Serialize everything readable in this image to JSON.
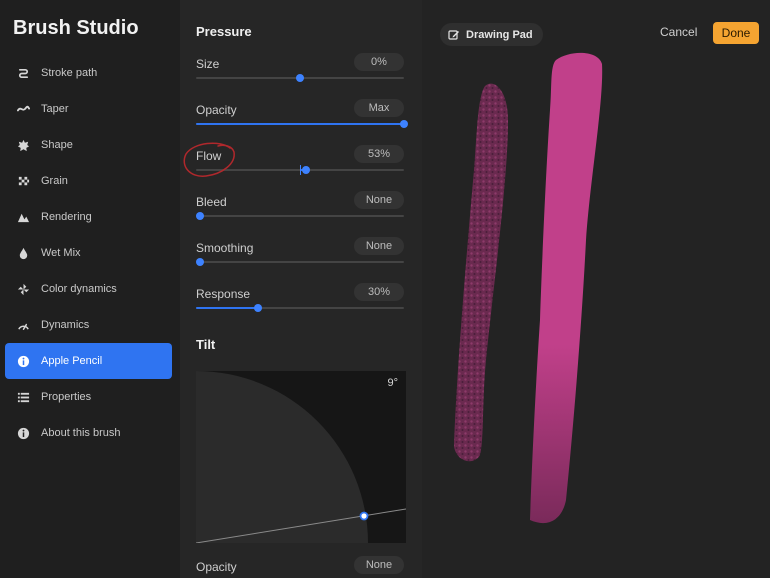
{
  "app": {
    "title": "Brush Studio"
  },
  "sidebar": {
    "items": [
      {
        "label": "Stroke path",
        "icon": "stroke-path-icon",
        "active": false
      },
      {
        "label": "Taper",
        "icon": "taper-icon",
        "active": false
      },
      {
        "label": "Shape",
        "icon": "shape-icon",
        "active": false
      },
      {
        "label": "Grain",
        "icon": "grain-icon",
        "active": false
      },
      {
        "label": "Rendering",
        "icon": "rendering-icon",
        "active": false
      },
      {
        "label": "Wet Mix",
        "icon": "wet-mix-icon",
        "active": false
      },
      {
        "label": "Color dynamics",
        "icon": "color-dynamics-icon",
        "active": false
      },
      {
        "label": "Dynamics",
        "icon": "dynamics-icon",
        "active": false
      },
      {
        "label": "Apple Pencil",
        "icon": "apple-pencil-icon",
        "active": true
      },
      {
        "label": "Properties",
        "icon": "properties-icon",
        "active": false
      },
      {
        "label": "About this brush",
        "icon": "about-icon",
        "active": false
      }
    ]
  },
  "pressure": {
    "title": "Pressure",
    "rows": [
      {
        "label": "Size",
        "value": "0%",
        "level": 0.5
      },
      {
        "label": "Opacity",
        "value": "Max",
        "level": 1.0
      },
      {
        "label": "Flow",
        "value": "53%",
        "level": 0.53
      },
      {
        "label": "Bleed",
        "value": "None",
        "level": 0
      },
      {
        "label": "Smoothing",
        "value": "None",
        "level": 0
      },
      {
        "label": "Response",
        "value": "30%",
        "level": 0.3
      }
    ]
  },
  "tilt": {
    "title": "Tilt",
    "angle": "9°",
    "opacity_label": "Opacity",
    "opacity_value": "None"
  },
  "canvas": {
    "pad_label": "Drawing Pad",
    "cancel_label": "Cancel",
    "done_label": "Done"
  },
  "colors": {
    "accent": "#2f74f1",
    "done": "#f5a431",
    "stroke": "#c1408a",
    "annotation": "#b0282c"
  }
}
